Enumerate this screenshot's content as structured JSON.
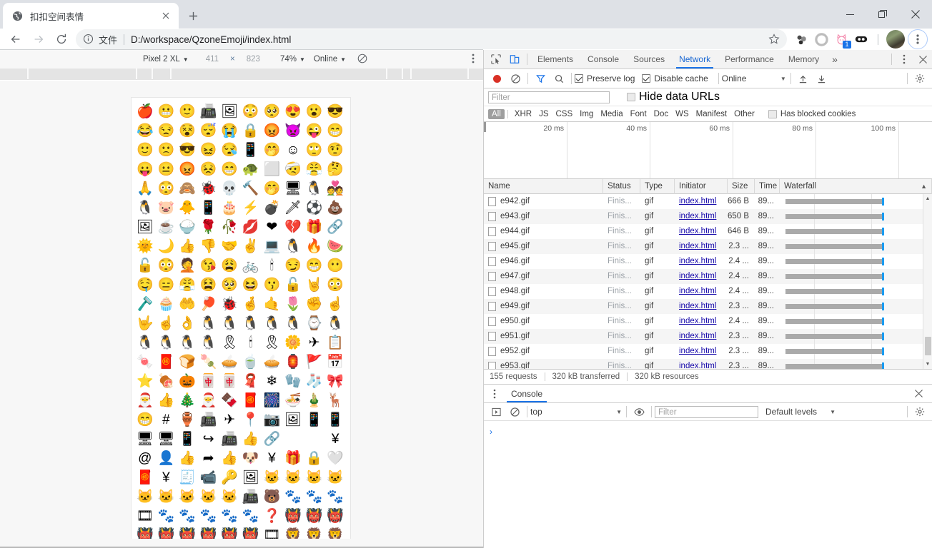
{
  "browser": {
    "tab": {
      "title": "扣扣空间表情",
      "favicon_icon": "globe-icon",
      "close_icon": "close-icon"
    },
    "new_tab_label": "+",
    "window_controls": {
      "minimize": "minimize-icon",
      "restore": "restore-icon",
      "close": "close-icon"
    },
    "nav": {
      "back_icon": "back-arrow-icon",
      "forward_icon": "forward-arrow-icon",
      "reload_icon": "reload-icon"
    },
    "omnibox": {
      "info_icon": "info-circle-icon",
      "scheme_label": "文件",
      "url": "D:/workspace/QzoneEmoji/index.html",
      "star_icon": "star-icon"
    },
    "extensions": [
      {
        "name": "molecule-extension-icon",
        "badge": ""
      },
      {
        "name": "circle-extension-icon",
        "badge": ""
      },
      {
        "name": "cat-extension-icon",
        "badge": "1"
      },
      {
        "name": "oval-extension-icon",
        "badge": ""
      }
    ],
    "profile_name": "avatar",
    "menu_icon": "three-dot-menu-icon"
  },
  "device_toolbar": {
    "device": "Pixel 2 XL",
    "width": "411",
    "multiply": "×",
    "height": "823",
    "zoom": "74%",
    "network": "Online",
    "rotate_icon": "rotate-icon",
    "more_icon": "three-dot-menu-icon",
    "caret": "▼"
  },
  "page": {
    "emoji_rows": [
      [
        "🍎",
        "😬",
        "🙂",
        "📠",
        "🖼",
        "😳",
        "🥺",
        "😍",
        "😮",
        "😎"
      ],
      [
        "😂",
        "😒",
        "😵",
        "😴",
        "😭",
        "🔒",
        "😡",
        "👿",
        "😜",
        "😁"
      ],
      [
        "🙂",
        "🙁",
        "😎",
        "😖",
        "😪",
        "📱",
        "🤭",
        "☺",
        "🙄",
        "🤨"
      ],
      [
        "😛",
        "😐",
        "😡",
        "😣",
        "😁",
        "🐢",
        "⬜",
        "🤕",
        "😤",
        "🤔"
      ],
      [
        "🙏",
        "😳",
        "🙈",
        "🐞",
        "💀",
        "🔨",
        "🤭",
        "🖥",
        "🐧",
        "💑"
      ],
      [
        "🐧",
        "🐷",
        "🐥",
        "📱",
        "🎂",
        "⚡",
        "💣",
        "🗡",
        "⚽",
        "💩"
      ],
      [
        "🖼",
        "☕",
        "🍚",
        "🌹",
        "🥀",
        "💋",
        "❤",
        "💔",
        "🎁",
        "🔗"
      ],
      [
        "🌞",
        "🌙",
        "👍",
        "👎",
        "🤝",
        "✌",
        "💻",
        "🐧",
        "🔥",
        "🍉"
      ],
      [
        "🔓",
        "😳",
        "🤦",
        "😘",
        "😩",
        "🚲",
        "🕯",
        "😏",
        "😁",
        "😶"
      ],
      [
        "🤤",
        "😑",
        "😤",
        "😫",
        "🥺",
        "😆",
        "😗",
        "🔓",
        "🤘",
        "😳"
      ],
      [
        "🪒",
        "🧁",
        "🤲",
        "🏓",
        "🐞",
        "🤞",
        "🤙",
        "🌷",
        "✊",
        "☝"
      ],
      [
        "🤟",
        "☝",
        "👌",
        "🐧",
        "🐧",
        "🐧",
        "🐧",
        "🐧",
        "⌚",
        "🐧"
      ],
      [
        "🐧",
        "🐧",
        "🐧",
        "🐧",
        "🎗",
        "🕯",
        "🎗",
        "🌼",
        "✈",
        "📋"
      ],
      [
        "🍬",
        "🧧",
        "🍞",
        "🍡",
        "🥧",
        "🍵",
        "🥧",
        "🏮",
        "🚩",
        "📅"
      ],
      [
        "⭐",
        "🍖",
        "🎃",
        "🀄",
        "🀄",
        "🧣",
        "❄",
        "🧤",
        "🧦",
        "🎀"
      ],
      [
        "🎅",
        "👍",
        "🎄",
        "🎅",
        "🍫",
        "🧧",
        "🎆",
        "🍜",
        "🎍",
        "🦌"
      ],
      [
        "😁",
        "#",
        "🏺",
        "📠",
        "✈",
        "📍",
        "📷",
        "🖼",
        "📱",
        "📱"
      ],
      [
        "🖥",
        "🖥",
        "📱",
        "↪",
        "📠",
        "👍",
        "🔗",
        "",
        "",
        "¥"
      ],
      [
        "@",
        "👤",
        "👍",
        "➦",
        "👍",
        "🐶",
        "¥",
        "🎁",
        "🔒",
        "🤍"
      ],
      [
        "🧧",
        "¥",
        "🧾",
        "📹",
        "🔑",
        "🖼",
        "🐱",
        "🐱",
        "🐱",
        "🐱"
      ],
      [
        "🐱",
        "🐱",
        "🐱",
        "🐱",
        "🐱",
        "📠",
        "🐻",
        "🐾",
        "🐾",
        "🐾"
      ],
      [
        "🎞",
        "🐾",
        "🐾",
        "🐾",
        "🐾",
        "🐾",
        "❓",
        "👹",
        "👹",
        "👹"
      ],
      [
        "👹",
        "👹",
        "👹",
        "👹",
        "👹",
        "👹",
        "🎞",
        "🦁",
        "🦁",
        "🦁"
      ]
    ]
  },
  "devtools": {
    "left_icons": [
      "inspect-element-icon",
      "device-toolbar-icon"
    ],
    "tabs": [
      {
        "label": "Elements",
        "active": false
      },
      {
        "label": "Console",
        "active": false
      },
      {
        "label": "Sources",
        "active": false
      },
      {
        "label": "Network",
        "active": true
      },
      {
        "label": "Performance",
        "active": false
      },
      {
        "label": "Memory",
        "active": false
      }
    ],
    "more_tabs_label": "»",
    "panel_menu_icon": "three-dot-menu-icon",
    "panel_close_icon": "close-icon",
    "network_toolbar": {
      "record_icon": "record-icon",
      "clear_icon": "clear-icon",
      "filter_icon": "filter-funnel-icon",
      "search_icon": "search-icon",
      "preserve_log_label": "Preserve log",
      "preserve_log_checked": true,
      "disable_cache_label": "Disable cache",
      "disable_cache_checked": true,
      "throttling_value": "Online",
      "import_icon": "upload-icon",
      "export_icon": "download-icon",
      "settings_icon": "gear-icon"
    },
    "filter_bar": {
      "filter_placeholder": "Filter",
      "hide_data_urls_label": "Hide data URLs",
      "hide_data_urls_checked": false
    },
    "resource_types": [
      "All",
      "XHR",
      "JS",
      "CSS",
      "Img",
      "Media",
      "Font",
      "Doc",
      "WS",
      "Manifest",
      "Other"
    ],
    "active_resource_type": "All",
    "has_blocked_cookies_label": "Has blocked cookies",
    "has_blocked_cookies_checked": false,
    "overview_ticks": [
      "20 ms",
      "40 ms",
      "60 ms",
      "80 ms",
      "100 ms"
    ],
    "table_headers": [
      "Name",
      "Status",
      "Type",
      "Initiator",
      "Size",
      "Time",
      "Waterfall"
    ],
    "sort_indicator": "▲",
    "rows": [
      {
        "name": "e942.gif",
        "status": "Finis...",
        "type": "gif",
        "initiator": "index.html",
        "size": "666 B",
        "time": "89..."
      },
      {
        "name": "e943.gif",
        "status": "Finis...",
        "type": "gif",
        "initiator": "index.html",
        "size": "650 B",
        "time": "89..."
      },
      {
        "name": "e944.gif",
        "status": "Finis...",
        "type": "gif",
        "initiator": "index.html",
        "size": "646 B",
        "time": "89..."
      },
      {
        "name": "e945.gif",
        "status": "Finis...",
        "type": "gif",
        "initiator": "index.html",
        "size": "2.3 ...",
        "time": "89..."
      },
      {
        "name": "e946.gif",
        "status": "Finis...",
        "type": "gif",
        "initiator": "index.html",
        "size": "2.4 ...",
        "time": "89..."
      },
      {
        "name": "e947.gif",
        "status": "Finis...",
        "type": "gif",
        "initiator": "index.html",
        "size": "2.4 ...",
        "time": "89..."
      },
      {
        "name": "e948.gif",
        "status": "Finis...",
        "type": "gif",
        "initiator": "index.html",
        "size": "2.4 ...",
        "time": "89..."
      },
      {
        "name": "e949.gif",
        "status": "Finis...",
        "type": "gif",
        "initiator": "index.html",
        "size": "2.3 ...",
        "time": "89..."
      },
      {
        "name": "e950.gif",
        "status": "Finis...",
        "type": "gif",
        "initiator": "index.html",
        "size": "2.4 ...",
        "time": "89..."
      },
      {
        "name": "e951.gif",
        "status": "Finis...",
        "type": "gif",
        "initiator": "index.html",
        "size": "2.3 ...",
        "time": "89..."
      },
      {
        "name": "e952.gif",
        "status": "Finis...",
        "type": "gif",
        "initiator": "index.html",
        "size": "2.3 ...",
        "time": "89..."
      },
      {
        "name": "e953.gif",
        "status": "Finis...",
        "type": "gif",
        "initiator": "index.html",
        "size": "2.3 ...",
        "time": "89..."
      }
    ],
    "status_bar": {
      "requests": "155 requests",
      "transferred": "320 kB transferred",
      "resources": "320 kB resources"
    },
    "drawer": {
      "menu_icon": "three-dot-menu-icon",
      "tab_label": "Console",
      "close_icon": "close-icon",
      "execute_icon": "execute-context-icon",
      "clear_icon": "clear-icon",
      "context": "top",
      "eye_icon": "eye-icon",
      "filter_placeholder": "Filter",
      "levels": "Default levels",
      "settings_icon": "gear-icon",
      "prompt": "›"
    }
  },
  "colors": {
    "accent_blue": "#1a73e8",
    "link_blue": "#1a0dab",
    "record_red": "#d93025",
    "waterfall_bar": "#aaaaaa",
    "waterfall_tick": "#1a9bf0",
    "tabstrip_bg": "#dee1e6"
  }
}
